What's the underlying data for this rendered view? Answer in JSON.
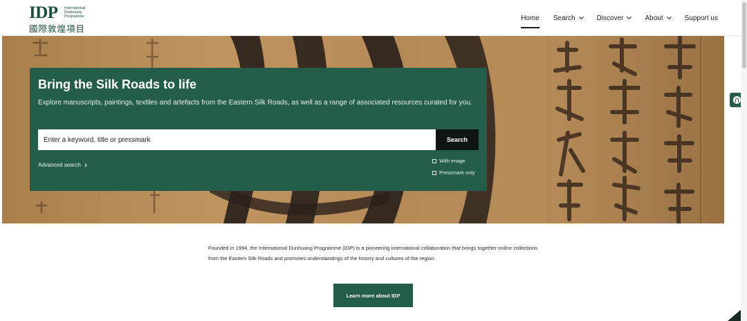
{
  "brand": {
    "mark": "IDP",
    "sub_lines": [
      "International",
      "Dunhuang",
      "Programme"
    ],
    "cjk_name": "國際敦煌項目"
  },
  "nav": {
    "items": [
      {
        "label": "Home",
        "active": true,
        "dropdown": false
      },
      {
        "label": "Search",
        "active": false,
        "dropdown": true
      },
      {
        "label": "Discover",
        "active": false,
        "dropdown": true
      },
      {
        "label": "About",
        "active": false,
        "dropdown": true
      },
      {
        "label": "Support us",
        "active": false,
        "dropdown": false
      }
    ]
  },
  "hero": {
    "title": "Bring the Silk Roads to life",
    "description": "Explore manuscripts, paintings, textiles and artefacts from the Eastern Silk Roads, as well as a range of associated resources curated for you.",
    "search_placeholder": "Enter a keyword, title or pressmark",
    "search_button": "Search",
    "advanced_link": "Advanced search",
    "filters": [
      {
        "label": "With image",
        "checked": false
      },
      {
        "label": "Pressmark only",
        "checked": false
      }
    ]
  },
  "about": {
    "text": "Founded in 1994, the International Dunhuang Programme (IDP) is a pioneering international collaboration that brings together online collections from the Eastern Silk Roads and promotes understandings of the history and cultures of the region.",
    "button": "Learn more about IDP"
  },
  "colors": {
    "brand_green": "#255d4b",
    "search_button": "#0f1512",
    "parchment": "#b58b56"
  },
  "icons": {
    "accessibility": "accessibility-icon",
    "dropdown": "chevron-down-icon",
    "advanced": "chevron-right-icon"
  }
}
